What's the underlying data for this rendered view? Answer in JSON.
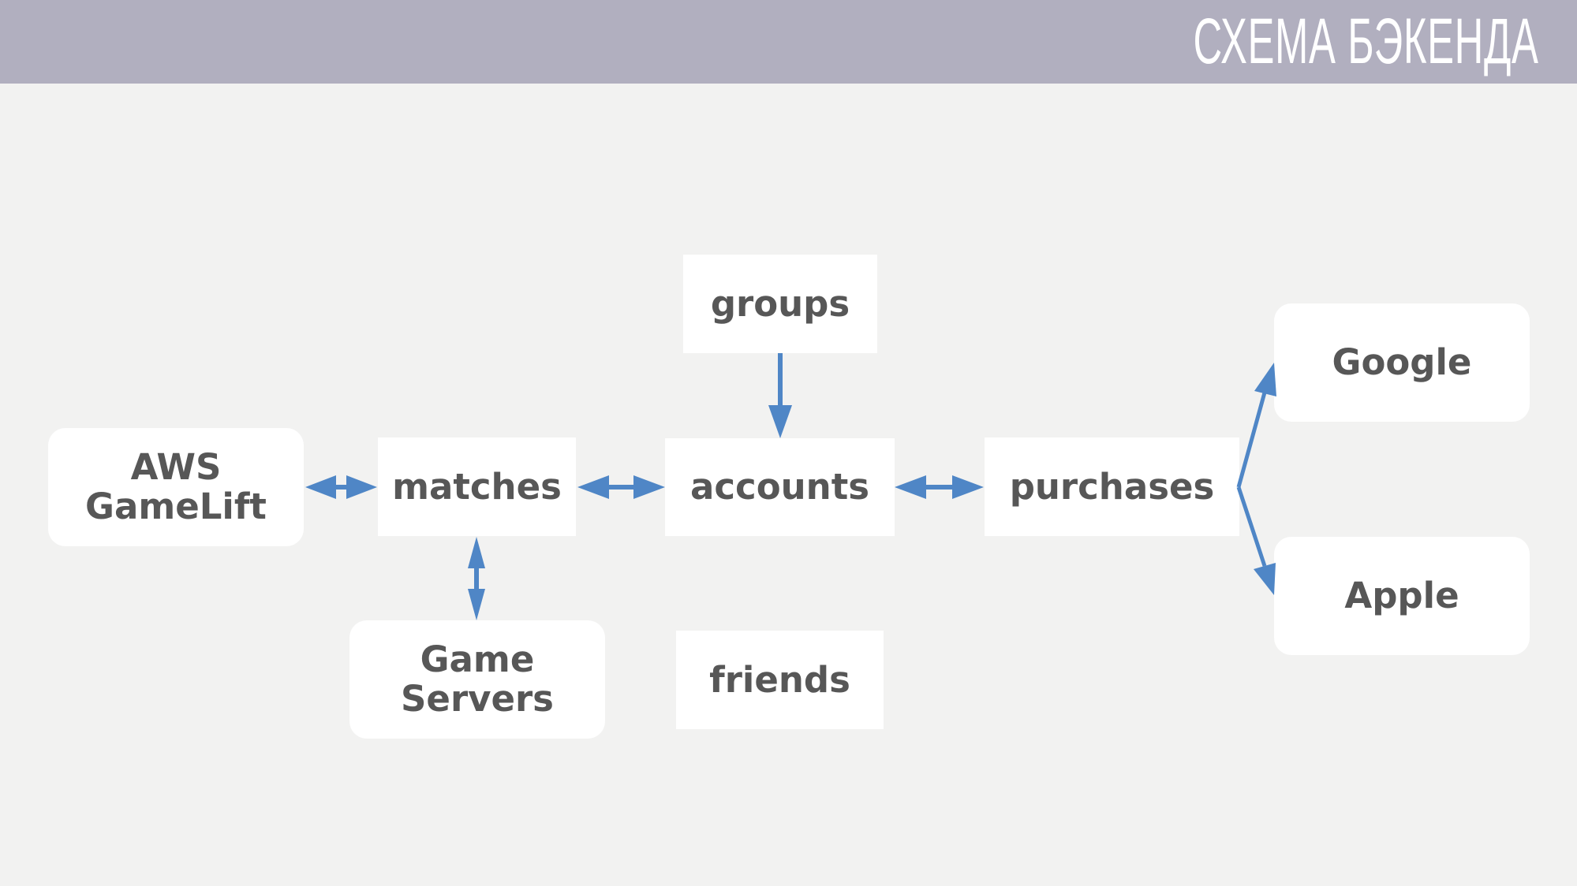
{
  "header": {
    "title": "СХЕМА БЭКЕНДА",
    "background_color": "#b1afbf"
  },
  "colors": {
    "background": "#f2f2f1",
    "node_fill": "#ffffff",
    "node_text": "#575757",
    "arrow": "#4f86c6"
  },
  "nodes": {
    "aws_gamelift": {
      "line1": "AWS",
      "line2": "GameLift",
      "shape": "rounded"
    },
    "matches": {
      "label": "matches",
      "shape": "square"
    },
    "groups": {
      "label": "groups",
      "shape": "square"
    },
    "accounts": {
      "label": "accounts",
      "shape": "square"
    },
    "purchases": {
      "label": "purchases",
      "shape": "square"
    },
    "google": {
      "label": "Google",
      "shape": "rounded"
    },
    "apple": {
      "label": "Apple",
      "shape": "rounded"
    },
    "game_servers": {
      "line1": "Game",
      "line2": "Servers",
      "shape": "rounded"
    },
    "friends": {
      "label": "friends",
      "shape": "square"
    }
  },
  "edges": [
    {
      "from": "AWS GameLift",
      "to": "matches",
      "direction": "bidirectional"
    },
    {
      "from": "matches",
      "to": "accounts",
      "direction": "bidirectional"
    },
    {
      "from": "accounts",
      "to": "purchases",
      "direction": "bidirectional"
    },
    {
      "from": "groups",
      "to": "accounts",
      "direction": "one-way"
    },
    {
      "from": "matches",
      "to": "Game Servers",
      "direction": "bidirectional"
    },
    {
      "from": "purchases",
      "to": "Google",
      "direction": "one-way"
    },
    {
      "from": "purchases",
      "to": "Apple",
      "direction": "one-way"
    }
  ]
}
